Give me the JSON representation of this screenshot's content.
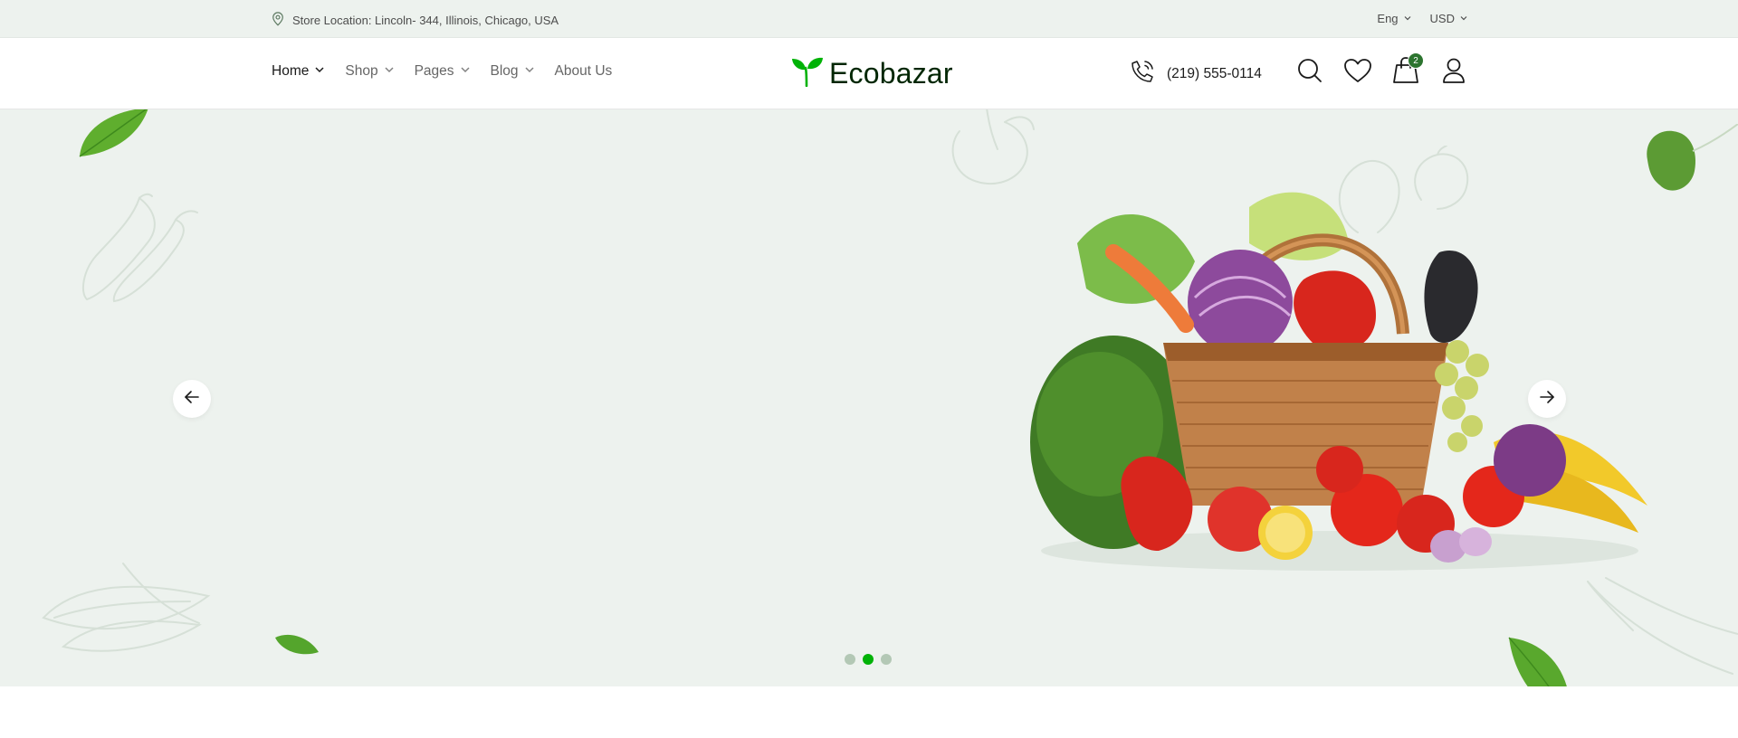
{
  "topbar": {
    "location": "Store Location: Lincoln- 344, Illinois, Chicago, USA",
    "language": "Eng",
    "currency": "USD"
  },
  "nav": {
    "items": [
      {
        "label": "Home",
        "has_dropdown": true,
        "active": true
      },
      {
        "label": "Shop",
        "has_dropdown": true,
        "active": false
      },
      {
        "label": "Pages",
        "has_dropdown": true,
        "active": false
      },
      {
        "label": "Blog",
        "has_dropdown": true,
        "active": false
      },
      {
        "label": "About Us",
        "has_dropdown": false,
        "active": false
      }
    ]
  },
  "brand": {
    "name": "Ecobazar",
    "icon": "leaf-sprout-icon",
    "color": "#00b207"
  },
  "contact": {
    "phone": "(219) 555-0114",
    "icon": "phone-call-icon"
  },
  "header_icons": {
    "search": "search-icon",
    "wishlist": "heart-icon",
    "cart": "shopping-bag-icon",
    "cart_count": "2",
    "account": "user-icon"
  },
  "hero": {
    "background": "#edf2ee",
    "image": "vegetable-basket",
    "prev_icon": "arrow-left-icon",
    "next_icon": "arrow-right-icon",
    "slides": 3,
    "active_slide": 2
  },
  "colors": {
    "accent": "#00b207",
    "badge": "#2c742f",
    "brand_text": "#002603"
  }
}
